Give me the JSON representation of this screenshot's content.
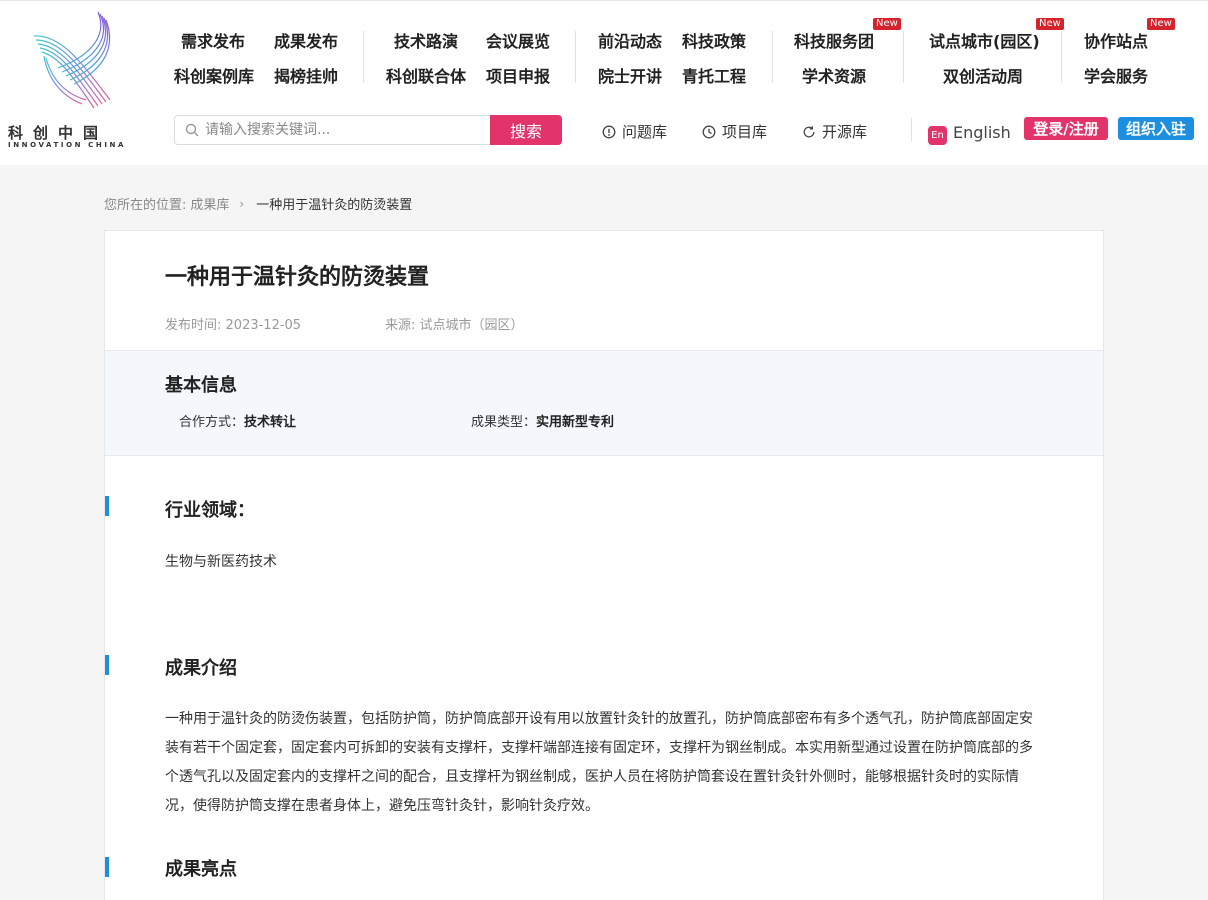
{
  "logo": {
    "cn": "科创中国",
    "en": "INNOVATION CHINA"
  },
  "nav": {
    "row1": [
      "需求发布",
      "成果发布",
      "技术路演",
      "会议展览",
      "前沿动态",
      "科技政策",
      "科技服务团",
      "试点城市(园区)",
      "协作站点"
    ],
    "row2": [
      "科创案例库",
      "揭榜挂帅",
      "科创联合体",
      "项目申报",
      "院士开讲",
      "青托工程",
      "学术资源",
      "双创活动周",
      "学会服务"
    ],
    "new_badge": "New"
  },
  "search": {
    "placeholder": "请输入搜索关键词...",
    "button": "搜索"
  },
  "quick_links": [
    "问题库",
    "项目库",
    "开源库"
  ],
  "lang": {
    "icon": "En",
    "label": "English"
  },
  "auth": {
    "login": "登录/注册",
    "org": "组织入驻"
  },
  "breadcrumb": {
    "prefix": "您所在的位置:",
    "parent": "成果库",
    "current": "一种用于温针灸的防烫装置"
  },
  "detail": {
    "title": "一种用于温针灸的防烫装置",
    "publish_label": "发布时间:",
    "publish_date": "2023-12-05",
    "source_label": "来源:",
    "source": "试点城市（园区）"
  },
  "basic_info": {
    "heading": "基本信息",
    "coop_label": "合作方式：",
    "coop_value": "技术转让",
    "type_label": "成果类型：",
    "type_value": "实用新型专利"
  },
  "sections": {
    "industry": {
      "heading": "行业领域：",
      "text": "生物与新医药技术"
    },
    "intro": {
      "heading": "成果介绍",
      "text": "一种用于温针灸的防烫伤装置，包括防护筒，防护筒底部开设有用以放置针灸针的放置孔，防护筒底部密布有多个透气孔，防护筒底部固定安装有若干个固定套，固定套内可拆卸的安装有支撑杆，支撑杆端部连接有固定环，支撑杆为钢丝制成。本实用新型通过设置在防护筒底部的多个透气孔以及固定套内的支撑杆之间的配合，且支撑杆为钢丝制成，医护人员在将防护筒套设在置针灸针外侧时，能够根据针灸时的实际情况，使得防护筒支撑在患者身体上，避免压弯针灸针，影响针灸疗效。"
    },
    "highlight": {
      "heading": "成果亮点"
    }
  },
  "colors": {
    "accent_pink": "#e2336b",
    "accent_blue": "#1c8fe0",
    "badge_red": "#d6222a"
  }
}
